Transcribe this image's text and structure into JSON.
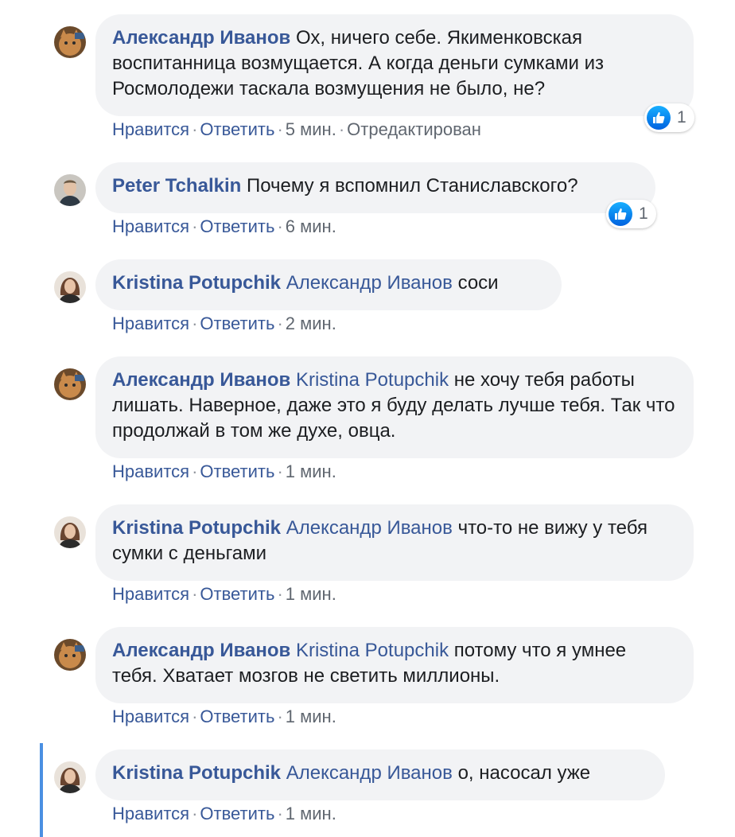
{
  "actions": {
    "like": "Нравится",
    "reply": "Ответить",
    "sep": "·"
  },
  "comments": [
    {
      "author": "Александр Иванов",
      "mention": "",
      "text": "Ох, ничего себе. Якименковская воспитанница возмущается. А когда деньги сумками из Росмолодежи таскала возмущения не было, не?",
      "time": "5 мин.",
      "edited": "Отредактирован",
      "reactions": "1",
      "avatar": "cat-avatar"
    },
    {
      "author": "Peter Tchalkin",
      "mention": "",
      "text": "Почему я вспомнил Станиславского?",
      "time": "6 мин.",
      "reactions": "1",
      "avatar": "man-avatar"
    },
    {
      "author": "Kristina Potupchik",
      "mention": "Александр Иванов",
      "text": "соси",
      "time": "2 мин.",
      "avatar": "woman-avatar"
    },
    {
      "author": "Александр Иванов",
      "mention": "Kristina Potupchik",
      "text": "не хочу тебя работы лишать. Наверное, даже это я буду делать лучше тебя. Так что продолжай в том же духе, овца.",
      "time": "1 мин.",
      "avatar": "cat-avatar"
    },
    {
      "author": "Kristina Potupchik",
      "mention": "Александр Иванов",
      "text": "что-то не вижу у тебя сумки с деньгами",
      "time": "1 мин.",
      "avatar": "woman-avatar"
    },
    {
      "author": "Александр Иванов",
      "mention": "Kristina Potupchik",
      "text": "потому что я умнее тебя. Хватает мозгов не светить миллионы.",
      "time": "1 мин.",
      "avatar": "cat-avatar"
    },
    {
      "author": "Kristina Potupchik",
      "mention": "Александр Иванов",
      "text": "о, насосал уже",
      "time": "1 мин.",
      "avatar": "woman-avatar"
    }
  ],
  "colors": {
    "link": "#385898",
    "bubble": "#f2f3f5",
    "meta": "#606770",
    "thread": "#4a90e2"
  }
}
